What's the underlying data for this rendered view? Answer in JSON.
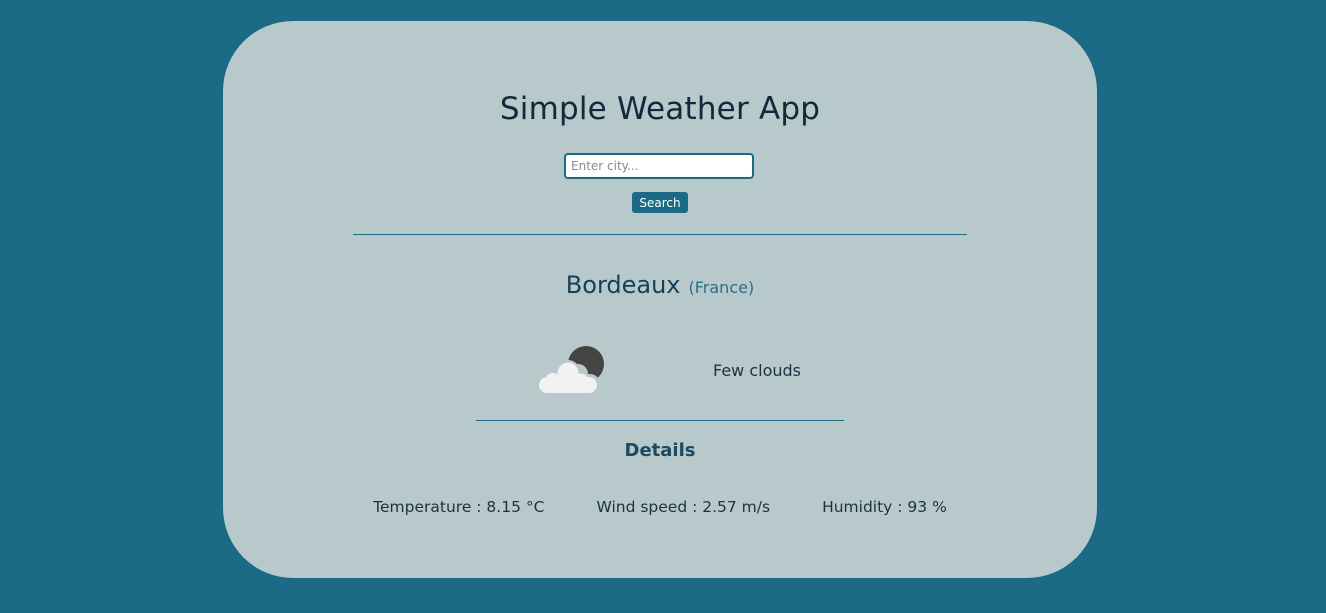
{
  "app": {
    "title": "Simple Weather App"
  },
  "search": {
    "placeholder": "Enter city...",
    "value": "",
    "button_label": "Search"
  },
  "location": {
    "city": "Bordeaux",
    "country": "(France)"
  },
  "weather": {
    "icon": "few-clouds-night-icon",
    "description": "Few clouds"
  },
  "details": {
    "title": "Details",
    "temperature": "Temperature : 8.15 °C",
    "wind_speed": "Wind speed : 2.57 m/s",
    "humidity": "Humidity : 93 %"
  },
  "colors": {
    "background": "#1b6a86",
    "card": "#b8c9cb",
    "accent": "#1b6a86"
  }
}
